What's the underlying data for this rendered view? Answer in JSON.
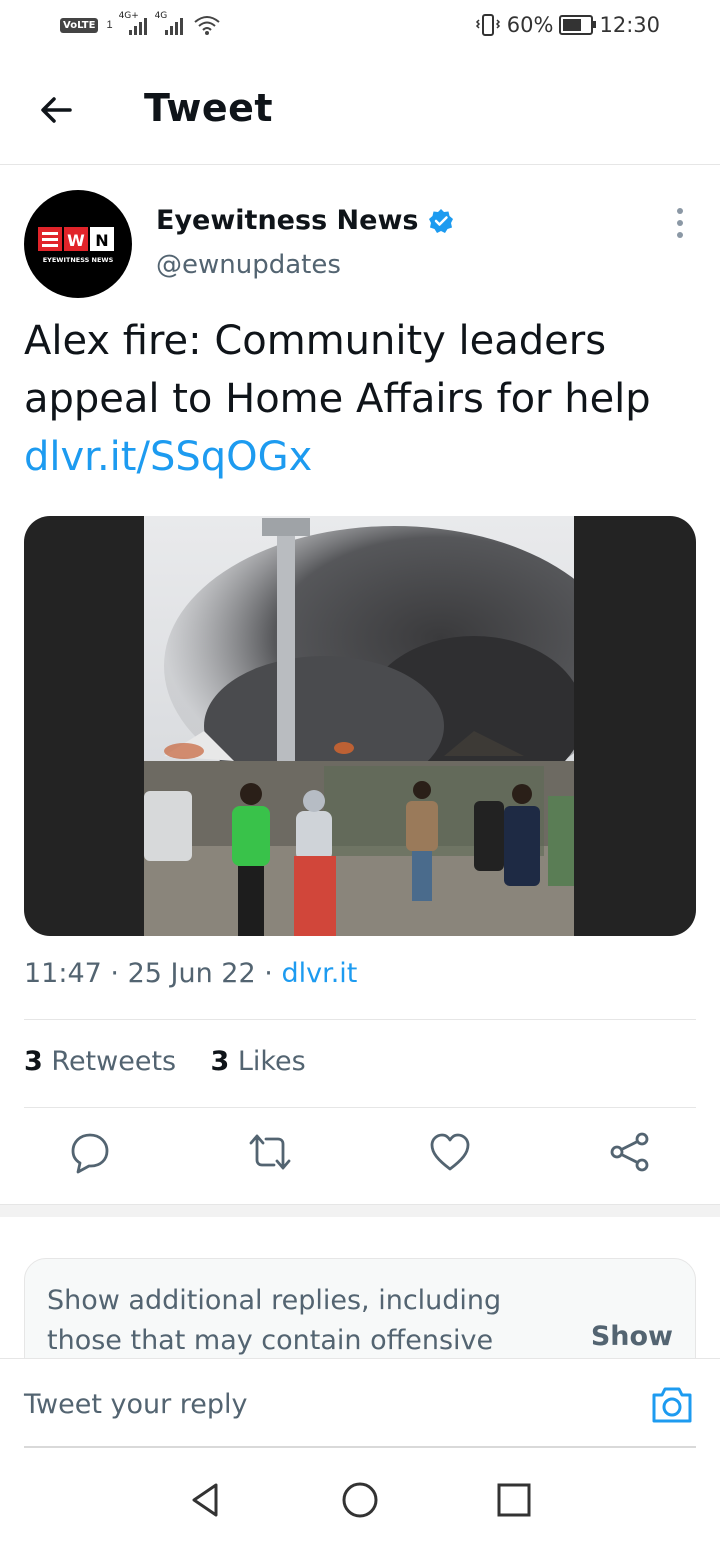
{
  "status_bar": {
    "volte": "VoLTE",
    "sim_slot": "1",
    "gen1": "4G+",
    "gen2": "4G",
    "battery_percent": "60%",
    "time": "12:30",
    "battery_level": 0.6
  },
  "header": {
    "title": "Tweet",
    "back_icon": "arrow-left-icon"
  },
  "author": {
    "name": "Eyewitness News",
    "handle": "@ewnupdates",
    "verified": true,
    "avatar_label": "EYEWITNESS NEWS",
    "logo_letters": [
      "E",
      "W",
      "N"
    ]
  },
  "tweet": {
    "text": "Alex fire: Community leaders appeal to Home Affairs for help",
    "link": "dlvr.it/SSqOGx",
    "time": "11:47",
    "date": "25 Jun 22",
    "source": "dlvr.it",
    "sep": "·"
  },
  "stats": {
    "retweets_count": "3",
    "retweets_label": "Retweets",
    "likes_count": "3",
    "likes_label": "Likes"
  },
  "actions": [
    "reply-icon",
    "retweet-icon",
    "like-icon",
    "share-icon"
  ],
  "more_replies": {
    "text": "Show additional replies, including those that may contain offensive",
    "button": "Show"
  },
  "reply": {
    "placeholder": "Tweet your reply",
    "camera_icon": "camera-icon"
  },
  "colors": {
    "accent": "#1d9bf0",
    "secondary_text": "#536471",
    "primary_text": "#0f1419",
    "ewn_red": "#e1242a"
  }
}
